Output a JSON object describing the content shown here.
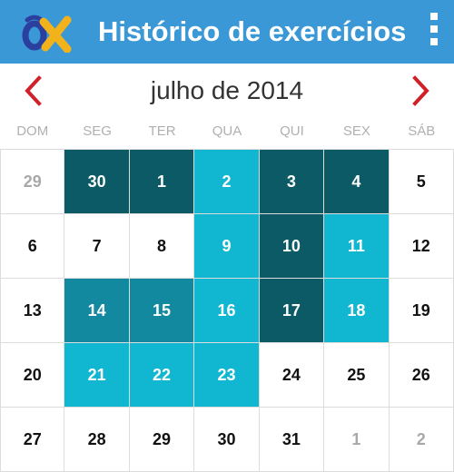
{
  "app": {
    "logo_icon": "alpha-logo-icon",
    "title": "Histórico de exercícios",
    "menu_icon": "overflow-menu-icon",
    "colors": {
      "appbar": "#3a98d6",
      "nav_arrow": "#d0202a"
    }
  },
  "calendar": {
    "month_label": "julho de 2014",
    "prev_icon": "chevron-left-icon",
    "next_icon": "chevron-right-icon",
    "weekdays": [
      "DOM",
      "SEG",
      "TER",
      "QUA",
      "QUI",
      "SEX",
      "SÁB"
    ],
    "intensity_colors": {
      "1": "#11b6d0",
      "2": "#12899e",
      "3": "#0b5a66"
    },
    "weeks": [
      [
        {
          "day": "29",
          "other": true,
          "level": 0
        },
        {
          "day": "30",
          "other": false,
          "level": 3
        },
        {
          "day": "1",
          "other": false,
          "level": 3
        },
        {
          "day": "2",
          "other": false,
          "level": 1
        },
        {
          "day": "3",
          "other": false,
          "level": 3
        },
        {
          "day": "4",
          "other": false,
          "level": 3
        },
        {
          "day": "5",
          "other": false,
          "level": 0
        }
      ],
      [
        {
          "day": "6",
          "other": false,
          "level": 0
        },
        {
          "day": "7",
          "other": false,
          "level": 0
        },
        {
          "day": "8",
          "other": false,
          "level": 0
        },
        {
          "day": "9",
          "other": false,
          "level": 1
        },
        {
          "day": "10",
          "other": false,
          "level": 3
        },
        {
          "day": "11",
          "other": false,
          "level": 1
        },
        {
          "day": "12",
          "other": false,
          "level": 0
        }
      ],
      [
        {
          "day": "13",
          "other": false,
          "level": 0
        },
        {
          "day": "14",
          "other": false,
          "level": 2
        },
        {
          "day": "15",
          "other": false,
          "level": 2
        },
        {
          "day": "16",
          "other": false,
          "level": 1
        },
        {
          "day": "17",
          "other": false,
          "level": 3
        },
        {
          "day": "18",
          "other": false,
          "level": 1
        },
        {
          "day": "19",
          "other": false,
          "level": 0
        }
      ],
      [
        {
          "day": "20",
          "other": false,
          "level": 0
        },
        {
          "day": "21",
          "other": false,
          "level": 1
        },
        {
          "day": "22",
          "other": false,
          "level": 1
        },
        {
          "day": "23",
          "other": false,
          "level": 1
        },
        {
          "day": "24",
          "other": false,
          "level": 0
        },
        {
          "day": "25",
          "other": false,
          "level": 0
        },
        {
          "day": "26",
          "other": false,
          "level": 0
        }
      ],
      [
        {
          "day": "27",
          "other": false,
          "level": 0
        },
        {
          "day": "28",
          "other": false,
          "level": 0
        },
        {
          "day": "29",
          "other": false,
          "level": 0
        },
        {
          "day": "30",
          "other": false,
          "level": 0
        },
        {
          "day": "31",
          "other": false,
          "level": 0
        },
        {
          "day": "1",
          "other": true,
          "level": 0
        },
        {
          "day": "2",
          "other": true,
          "level": 0
        }
      ]
    ]
  }
}
